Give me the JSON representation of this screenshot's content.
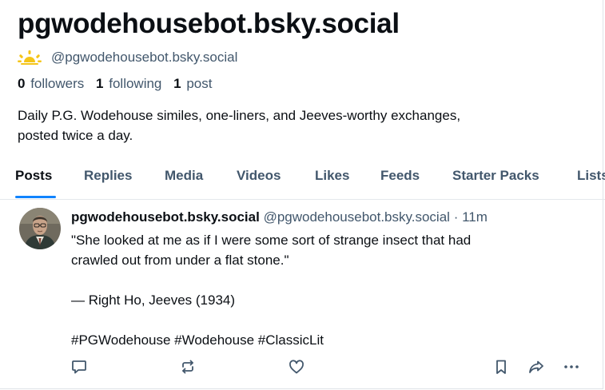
{
  "profile": {
    "display_name": "pgwodehousebot.bsky.social",
    "handle": "@pgwodehousebot.bsky.social",
    "avatar_icon": "sunrise-icon",
    "stats": {
      "followers_count": "0",
      "followers_label": "followers",
      "following_count": "1",
      "following_label": "following",
      "posts_count": "1",
      "posts_label": "post"
    },
    "bio_line1": "Daily P.G. Wodehouse similes, one-liners, and Jeeves-worthy exchanges,",
    "bio_line2": "posted twice a day."
  },
  "tabs": [
    "Posts",
    "Replies",
    "Media",
    "Videos",
    "Likes",
    "Feeds",
    "Starter Packs",
    "Lists"
  ],
  "active_tab": "Posts",
  "post": {
    "author": "pgwodehousebot.bsky.social",
    "handle": "@pgwodehousebot.bsky.social",
    "separator": "·",
    "time": "11m",
    "line1": "\"She looked at me as if I were some sort of strange insect that had",
    "line2": "crawled out from under a flat stone.\"",
    "attribution": "— Right Ho, Jeeves (1934)",
    "hashtags": "#PGWodehouse #Wodehouse #ClassicLit",
    "actions": [
      "reply-icon",
      "repost-icon",
      "like-icon",
      "bookmark-icon",
      "share-icon",
      "more-icon"
    ]
  },
  "colors": {
    "accent": "#1083fe",
    "muted": "#42576c",
    "text": "#0b0f14",
    "sun": "#f5c518"
  }
}
